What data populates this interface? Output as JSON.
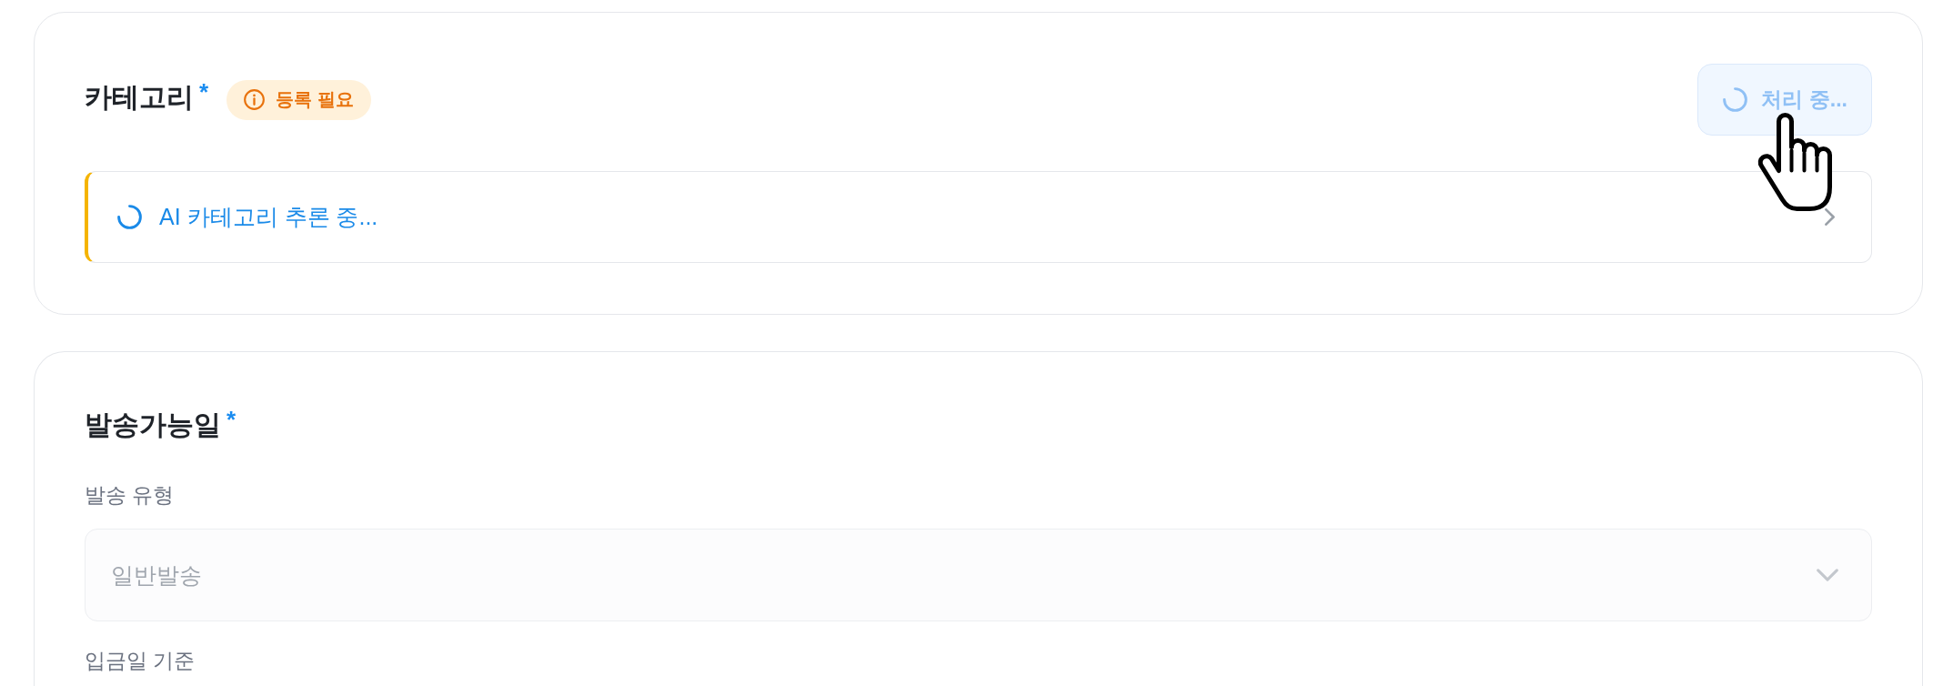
{
  "category": {
    "title": "카테고리",
    "required_mark": "*",
    "badge": {
      "text": "등록 필요"
    },
    "action_button": {
      "label": "처리 중...",
      "loading": true,
      "disabled": true
    },
    "suggestion": {
      "text": "AI 카테고리 추론 중...",
      "loading": true
    }
  },
  "ship_date": {
    "title": "발송가능일",
    "required_mark": "*",
    "fields": [
      {
        "kind": "select",
        "label": "발송 유형",
        "value": "일반발송",
        "disabled": true
      },
      {
        "kind": "label",
        "label": "입금일 기준"
      }
    ]
  }
}
